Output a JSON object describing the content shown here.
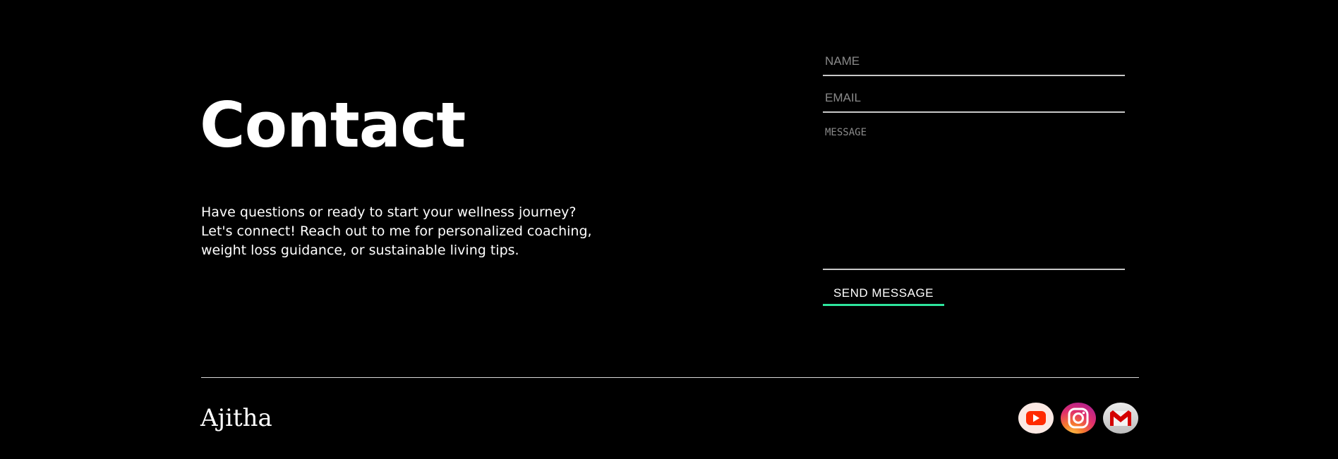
{
  "contact": {
    "title": "Contact",
    "description": "Have questions or ready to start your wellness journey? Let's connect! Reach out to me for personalized coaching, weight loss guidance, or sustainable living tips."
  },
  "form": {
    "name_placeholder": "NAME",
    "email_placeholder": "EMAIL",
    "message_placeholder": "MESSAGE",
    "send_label": "SEND MESSAGE",
    "accent_color": "#2ee59d"
  },
  "footer": {
    "brand": "Ajitha",
    "social": [
      {
        "icon": "youtube-icon",
        "color": "#ff0000"
      },
      {
        "icon": "instagram-icon",
        "color": "#e1306c"
      },
      {
        "icon": "gmail-icon",
        "color": "#d93025"
      }
    ]
  }
}
